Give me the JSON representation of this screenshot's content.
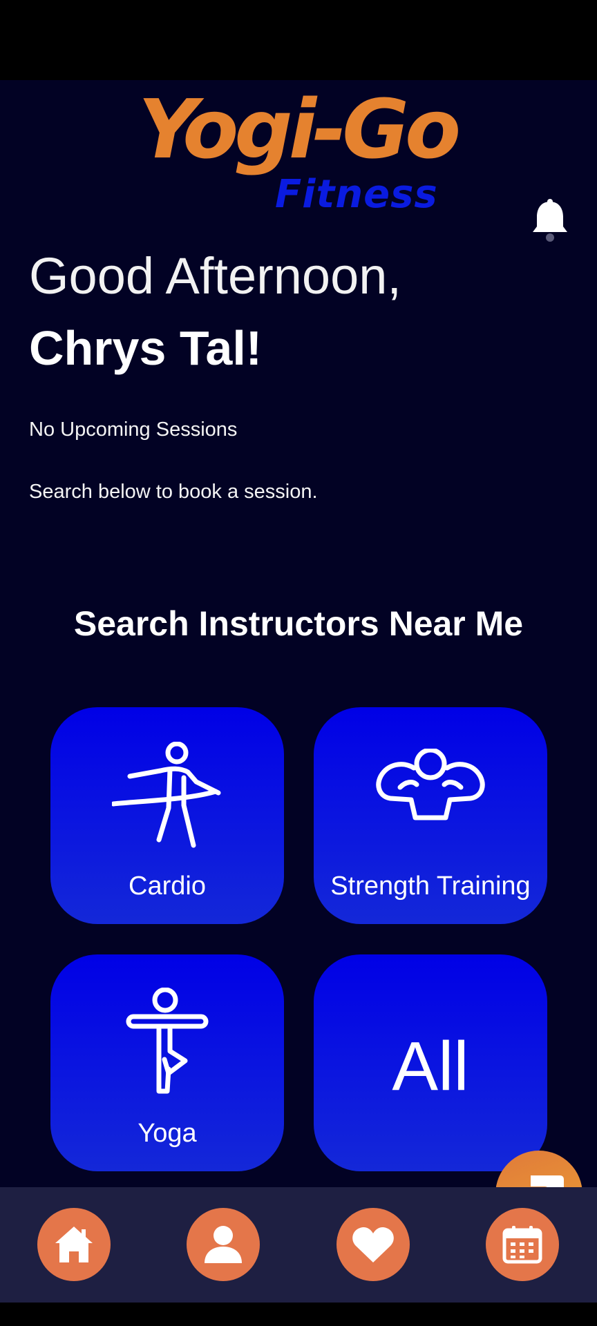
{
  "app": {
    "logo_main": "Yogi-Go",
    "logo_sub": "Fitness"
  },
  "greeting": {
    "line1": "Good Afternoon,",
    "name": "Chrys Tal!"
  },
  "sessions": {
    "status": "No Upcoming Sessions",
    "hint": "Search below to book a session."
  },
  "search": {
    "heading": "Search Instructors Near Me",
    "categories": [
      {
        "label": "Cardio",
        "icon": "cardio-runner-icon"
      },
      {
        "label": "Strength Training",
        "icon": "muscle-flex-icon"
      },
      {
        "label": "Yoga",
        "icon": "yoga-pose-icon"
      },
      {
        "label": "All",
        "icon": ""
      }
    ]
  },
  "nav": {
    "items": [
      {
        "icon": "home-icon"
      },
      {
        "icon": "profile-icon"
      },
      {
        "icon": "heart-icon"
      },
      {
        "icon": "calendar-icon"
      }
    ]
  },
  "colors": {
    "background": "#020224",
    "logo_orange": "#e5822f",
    "logo_blue": "#0a1be0",
    "tile_blue": "#0000e6",
    "nav_bg": "#1e1f42",
    "nav_button": "#e4764a",
    "chat_fab": "#e98c36"
  }
}
